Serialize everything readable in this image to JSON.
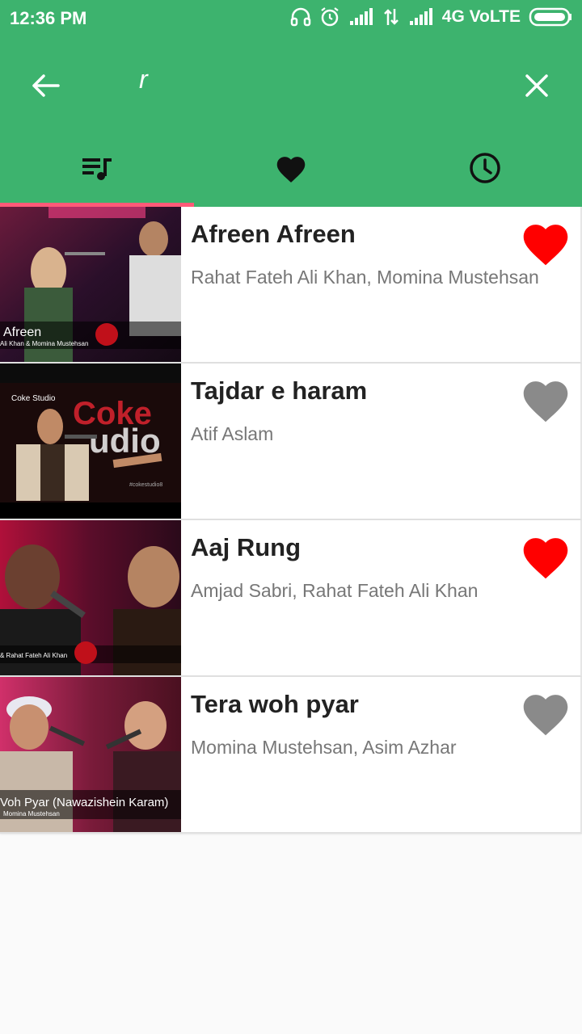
{
  "status": {
    "time": "12:36 PM",
    "network": "4G VoLTE"
  },
  "search": {
    "query": "r"
  },
  "tabs": [
    {
      "icon": "playlist-icon",
      "active": true
    },
    {
      "icon": "heart-icon",
      "active": false
    },
    {
      "icon": "clock-icon",
      "active": false
    }
  ],
  "colors": {
    "primary": "#3db36e",
    "indicator": "#ff5a78",
    "liked": "#ff0000",
    "unliked": "#8a8a8a"
  },
  "songs": [
    {
      "title": "Afreen Afreen",
      "artists": "Rahat Fateh Ali Khan, Momina Mustehsan",
      "liked": true,
      "thumb_caption": "Afreen",
      "thumb_subcaption": "Ali Khan & Momina Mustehsan"
    },
    {
      "title": "Tajdar e haram",
      "artists": "Atif Aslam",
      "liked": false,
      "thumb_caption": "Coke Studio",
      "thumb_subcaption": "#cokestudio8"
    },
    {
      "title": "Aaj Rung",
      "artists": "Amjad Sabri,  Rahat Fateh Ali Khan",
      "liked": true,
      "thumb_caption": "",
      "thumb_subcaption": "& Rahat Fateh Ali Khan"
    },
    {
      "title": "Tera woh pyar",
      "artists": "Momina Mustehsan, Asim Azhar",
      "liked": false,
      "thumb_caption": "Voh Pyar (Nawazishein Karam)",
      "thumb_subcaption": "Momina Mustehsan"
    }
  ]
}
